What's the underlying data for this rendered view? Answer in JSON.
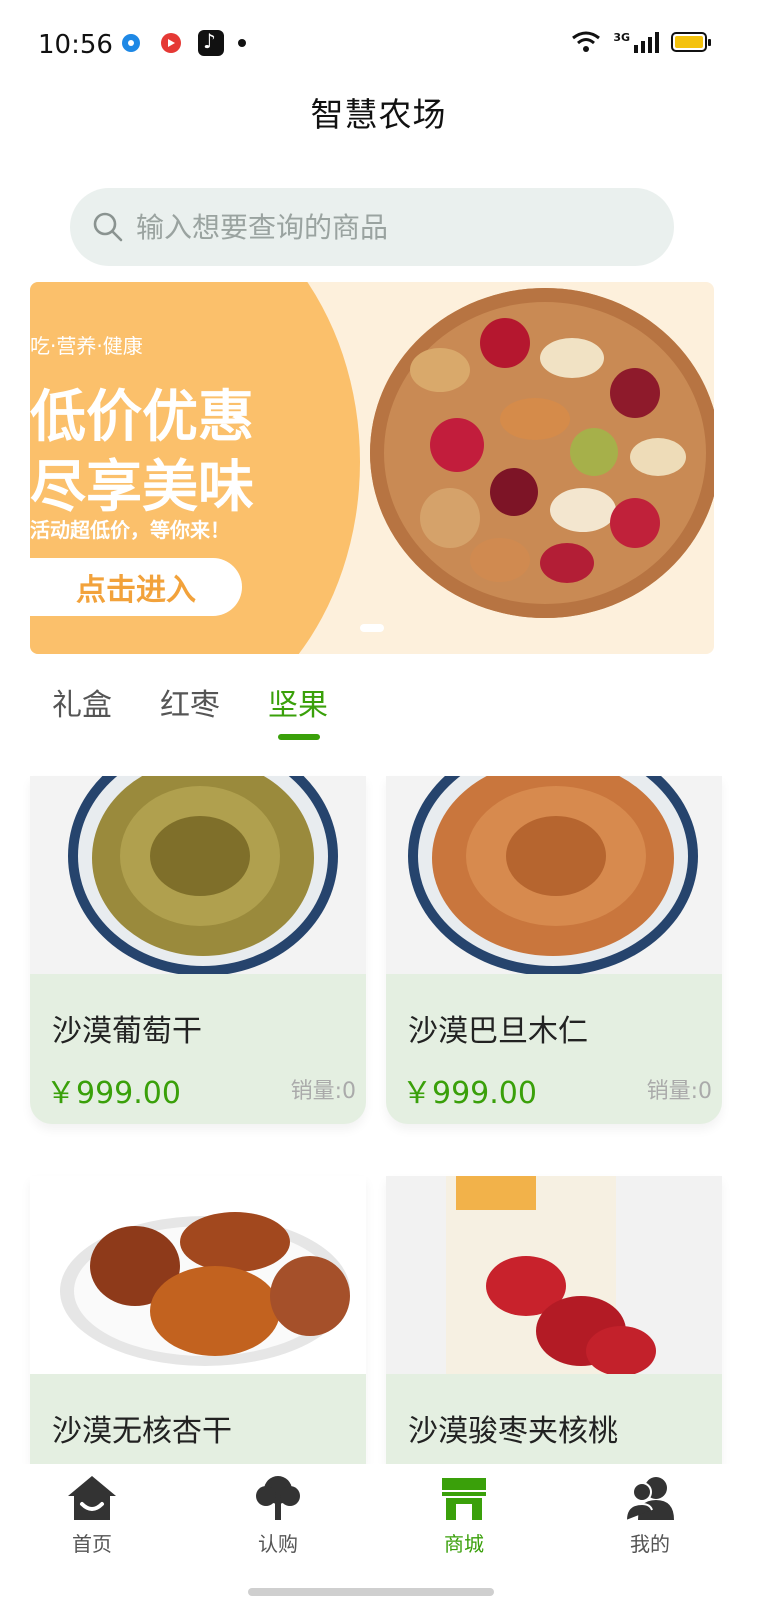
{
  "status_bar": {
    "time": "10:56",
    "network": "3G"
  },
  "header": {
    "title": "智慧农场"
  },
  "search": {
    "placeholder": "输入想要查询的商品"
  },
  "banner": {
    "slogan": "吃·营养·健康",
    "headline1": "低价优惠",
    "headline2": "尽享美味",
    "subtext": "活动超低价，等你来！",
    "button_label": "点击进入"
  },
  "tabs": [
    {
      "label": "礼盒",
      "active": false
    },
    {
      "label": "红枣",
      "active": false
    },
    {
      "label": "坚果",
      "active": true
    }
  ],
  "products": [
    {
      "name": "沙漠葡萄干",
      "price": "￥999.00",
      "sales": "销量:0",
      "image": "raisins"
    },
    {
      "name": "沙漠巴旦木仁",
      "price": "￥999.00",
      "sales": "销量:0",
      "image": "almonds"
    },
    {
      "name": "沙漠无核杏干",
      "price": "",
      "sales": "",
      "image": "dried-apricots"
    },
    {
      "name": "沙漠骏枣夹核桃",
      "price": "",
      "sales": "",
      "image": "dates-walnut"
    }
  ],
  "bottom_nav": [
    {
      "label": "首页",
      "icon": "home-icon",
      "active": false
    },
    {
      "label": "认购",
      "icon": "tree-icon",
      "active": false
    },
    {
      "label": "商城",
      "icon": "store-icon",
      "active": true
    },
    {
      "label": "我的",
      "icon": "user-icon",
      "active": false
    }
  ],
  "colors": {
    "accent": "#3aa00a",
    "banner_orange": "#fbc06b",
    "card_bg": "#e4efe1",
    "search_bg": "#eaf0ee"
  }
}
